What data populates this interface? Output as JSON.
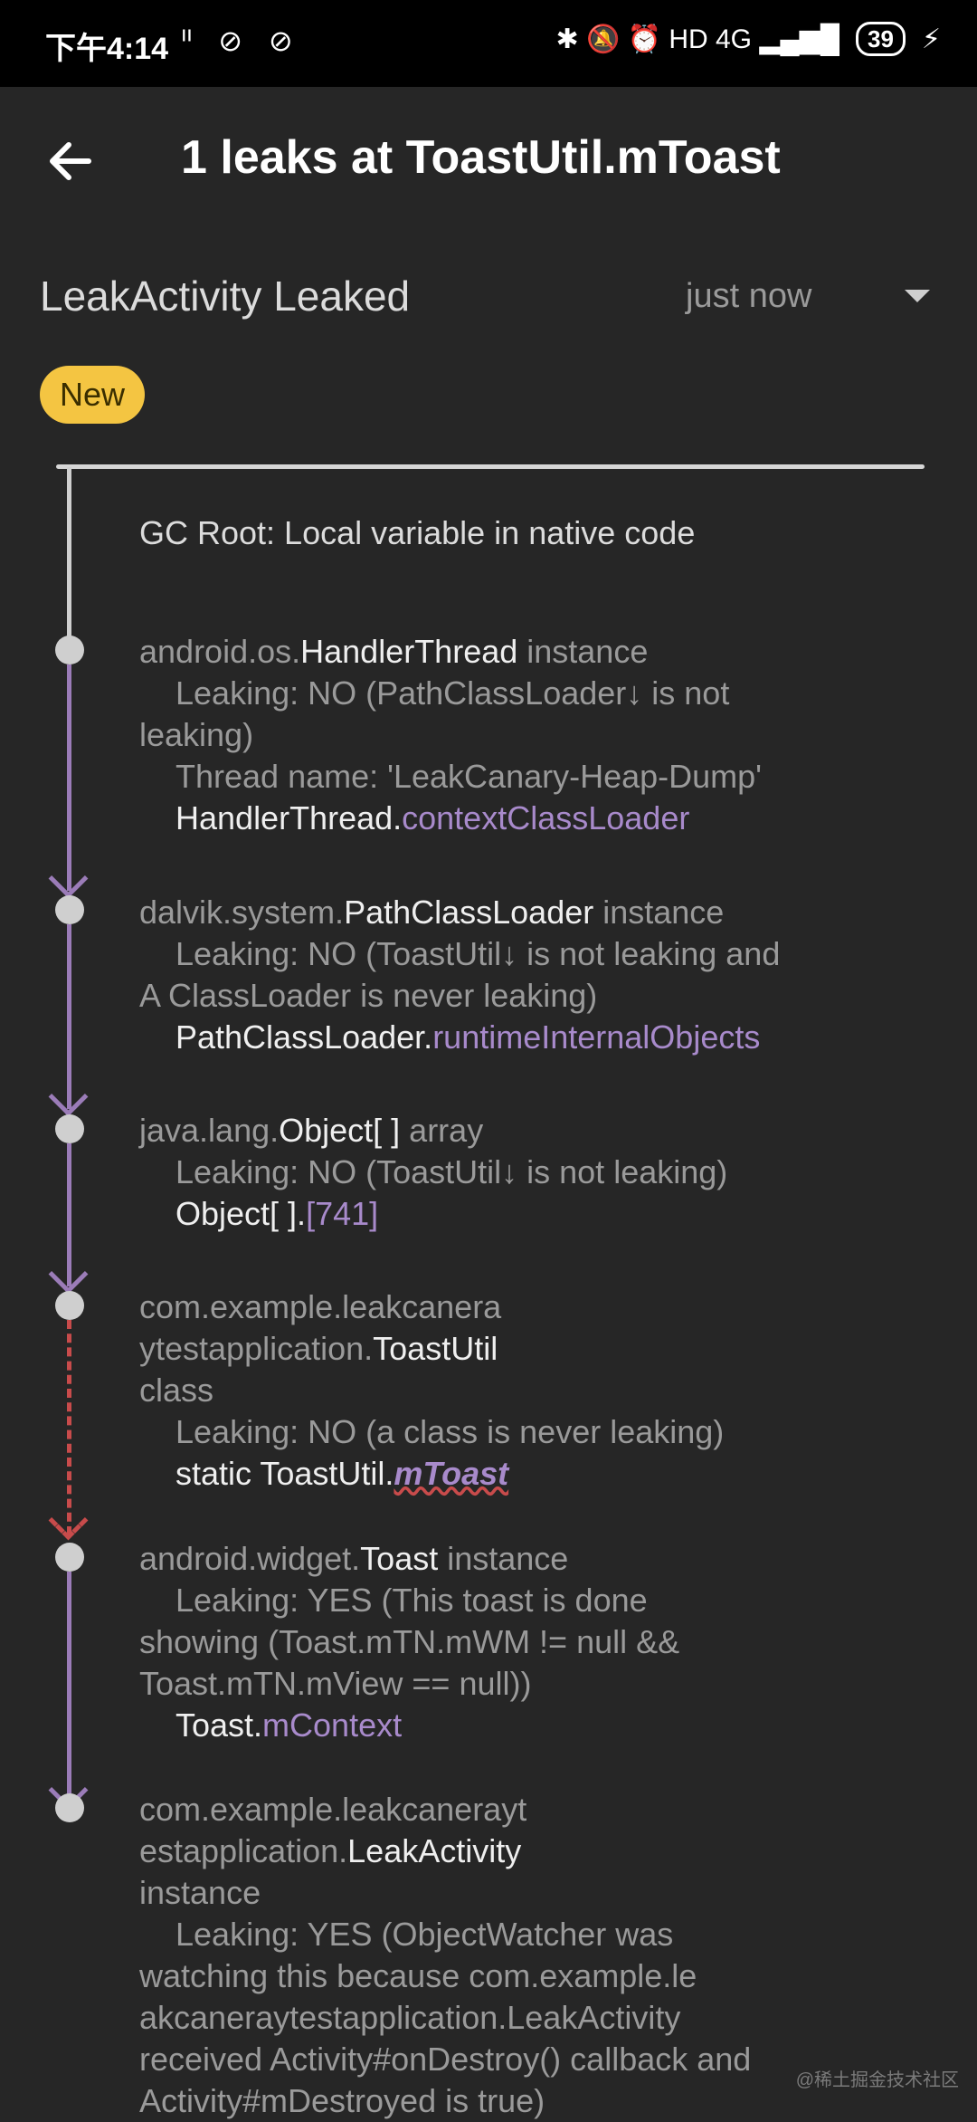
{
  "status_bar": {
    "time": "下午4:14",
    "left_icons": "ᐦ ⊘ ⊘",
    "right_icons": "✱ 🔕 ⏰ HD 4G ▂▄▆█",
    "battery": "39",
    "charging": "⚡"
  },
  "app_bar": {
    "back_icon": "arrow-left",
    "title": "1 leaks at ToastUtil.mToast"
  },
  "summary": {
    "title": "LeakActivity Leaked",
    "time": "just now",
    "badge": "New"
  },
  "trace": {
    "gc_root": "GC Root: Local variable in native code",
    "nodes": [
      {
        "pkg": "android.os.",
        "cls": "HandlerThread",
        "kind": " instance",
        "line1": "Leaking: NO (PathClassLoader↓ is not",
        "line1b": "leaking)",
        "line2": "Thread name: 'LeakCanary-Heap-Dump'",
        "ref_owner": "HandlerThread.",
        "ref_field": "contextClassLoader"
      },
      {
        "pkg": "dalvik.system.",
        "cls": "PathClassLoader",
        "kind": " instance",
        "line1": "Leaking: NO (ToastUtil↓ is not leaking and",
        "line1b": "A ClassLoader is never leaking)",
        "ref_owner": "PathClassLoader.",
        "ref_field": "runtimeInternalObjects"
      },
      {
        "pkg": "java.lang.",
        "cls": "Object[ ]",
        "kind": " array",
        "line1": "Leaking: NO (ToastUtil↓ is not leaking)",
        "ref_owner": "Object[ ].",
        "ref_field": "[741]"
      },
      {
        "pkg_a": "com.example.leakcanera",
        "pkg_b": "ytestapplication.",
        "cls": "ToastUtil",
        "kind": "class",
        "line1": "Leaking: NO (a class is never leaking)",
        "ref_owner": "static ToastUtil.",
        "ref_field": "mToast"
      },
      {
        "pkg": "android.widget.",
        "cls": "Toast",
        "kind": " instance",
        "line1": "Leaking: YES (This toast is done",
        "line1b": "showing (Toast.mTN.mWM != null &&",
        "line1c": "Toast.mTN.mView == null))",
        "ref_owner": "Toast.",
        "ref_field": "mContext"
      },
      {
        "pkg_a": "com.example.leakcanerayt",
        "pkg_b": "estapplication.",
        "cls": "LeakActivity",
        "kind": "instance",
        "line1": "Leaking: YES (ObjectWatcher was",
        "line1b": "watching this because com.example.le",
        "line1c": "akcaneraytestapplication.LeakActivity",
        "line1d": "received Activity#onDestroy() callback and",
        "line1e": "Activity#mDestroyed is true)"
      }
    ]
  },
  "watermark": "@稀土掘金技术社区"
}
